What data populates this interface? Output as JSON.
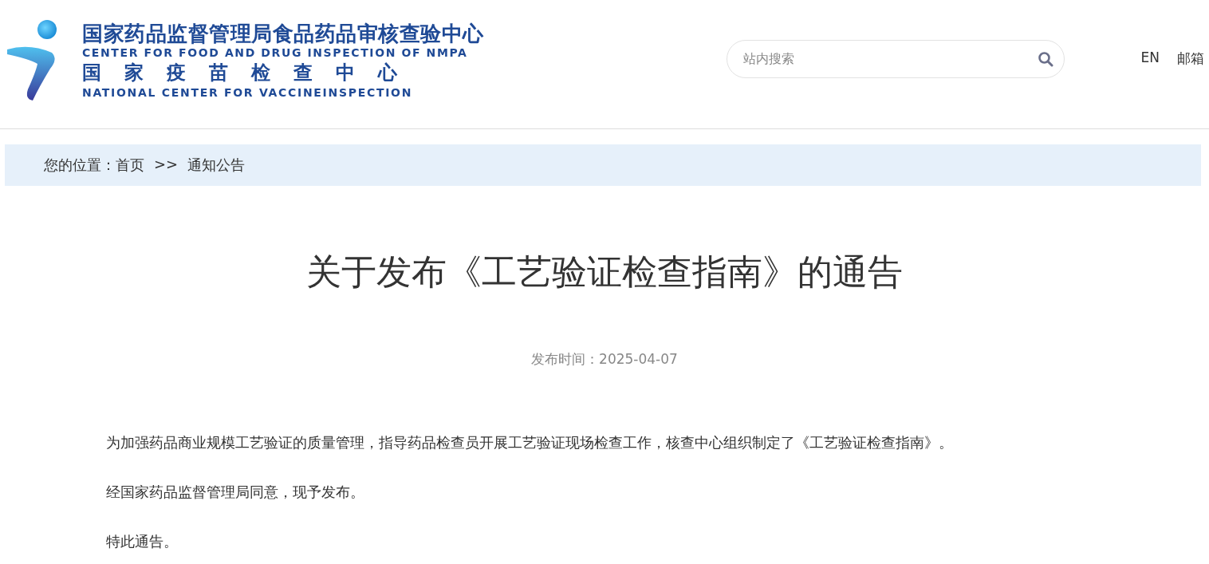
{
  "header": {
    "logo": {
      "title_cn": "国家药品监督管理局食品药品审核查验中心",
      "title_en": "CENTER FOR FOOD AND DRUG INSPECTION OF NMPA",
      "subtitle_cn": "国家疫苗检查中心",
      "subtitle_en": "NATIONAL CENTER FOR VACCINEINSPECTION"
    },
    "search": {
      "placeholder": "站内搜索"
    },
    "links": [
      "EN",
      "邮箱"
    ]
  },
  "breadcrumb": {
    "label": "您的位置：",
    "items": [
      {
        "text": "首页"
      },
      {
        "text": "通知公告"
      }
    ],
    "separator": ">>"
  },
  "article": {
    "title": "关于发布《工艺验证检查指南》的通告",
    "date": "发布时间：2025-04-07",
    "paragraphs": [
      "为加强药品商业规模工艺验证的质量管理，指导药品检查员开展工艺验证现场检查工作，核查中心组织制定了《工艺验证检查指南》。",
      "经国家药品监督管理局同意，现予发布。",
      "特此通告。"
    ]
  }
}
